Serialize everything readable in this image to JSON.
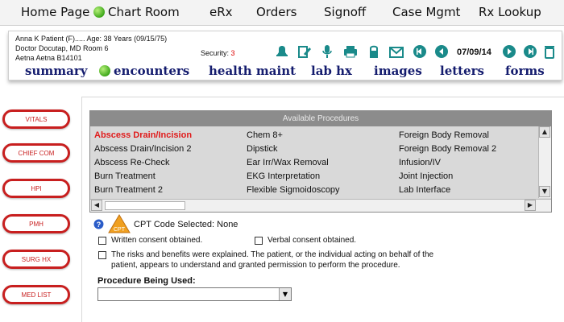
{
  "nav": {
    "home": "Home Page",
    "chart_room": "Chart Room",
    "erx": "eRx",
    "orders": "Orders",
    "signoff": "Signoff",
    "case_mgmt": "Case Mgmt",
    "rx_lookup": "Rx Lookup"
  },
  "patient": {
    "line1": "Anna K Patient (F)..... Age: 38 Years (09/15/75)",
    "line2": "Doctor Docutap, MD  Room 6",
    "line3": "Aetna Aetna B14101",
    "security_label": "Security:",
    "security_value": "3",
    "date": "07/09/14"
  },
  "toolbar_icons": [
    "bell-icon",
    "edit-icon",
    "microphone-icon",
    "printer-icon",
    "lock-icon",
    "envelope-icon",
    "first-icon",
    "prev-icon",
    "next-icon",
    "last-icon",
    "trash-icon"
  ],
  "tabs": {
    "summary": "summary",
    "encounters": "encounters",
    "health_maint": "health maint",
    "lab_hx": "lab hx",
    "images": "images",
    "letters": "letters",
    "forms": "forms"
  },
  "sidebar": [
    "VITALS",
    "CHIEF COM",
    "HPI",
    "PMH",
    "SURG HX",
    "MED LIST"
  ],
  "procedures": {
    "title": "Available Procedures",
    "col1": [
      "Abscess Drain/Incision",
      "Abscess Drain/Incision 2",
      "Abscess Re-Check",
      "Burn Treatment",
      "Burn Treatment 2"
    ],
    "col2": [
      "Chem 8+",
      "Dipstick",
      "Ear Irr/Wax Removal",
      "EKG Interpretation",
      "Flexible Sigmoidoscopy"
    ],
    "col3": [
      "Foreign Body Removal",
      "Foreign Body Removal 2",
      "Infusion/IV",
      "Joint Injection",
      "Lab Interface"
    ],
    "selected": "Abscess Drain/Incision"
  },
  "form": {
    "cpt_badge": "CPT",
    "cpt_text": "CPT Code Selected: None",
    "written_consent": "Written consent obtained.",
    "verbal_consent": "Verbal consent obtained.",
    "risks_line1": "The risks and benefits were explained. The patient, or the individual acting on behalf of the",
    "risks_line2": "patient, appears to understand and granted permission to perform the procedure.",
    "procedure_label": "Procedure Being Used:",
    "procedure_value": ""
  },
  "colors": {
    "accent_red": "#c81f1f",
    "tab_navy": "#141c6e",
    "toolbar_teal": "#1a8a8a",
    "selected_red": "#e01b1b"
  }
}
